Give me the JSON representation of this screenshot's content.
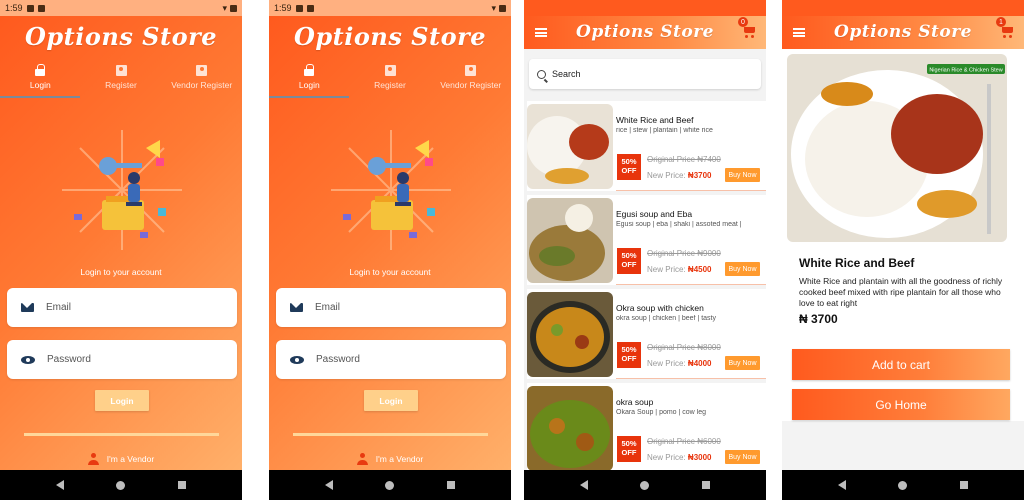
{
  "app": {
    "name": "Options Store"
  },
  "colors": {
    "primary": "#ff5a1e",
    "accent": "#e8340c",
    "button_light": "#ffd08a",
    "buy_button": "#ff9a2e"
  },
  "status": {
    "time": "1:59"
  },
  "login": {
    "tabs": [
      {
        "label": "Login",
        "icon": "lock-icon"
      },
      {
        "label": "Register",
        "icon": "badge-icon"
      },
      {
        "label": "Vendor Register",
        "icon": "badge-icon"
      }
    ],
    "subtitle": "Login to your account",
    "email_placeholder": "Email",
    "password_placeholder": "Password",
    "button_label": "Login",
    "vendor_link": "I'm a Vendor"
  },
  "list": {
    "cart_count": "0",
    "search_placeholder": "Search",
    "items": [
      {
        "title": "White Rice and Beef",
        "tags": "rice | stew | plantain | white rice",
        "discount_pct": "50%",
        "discount_label": "OFF",
        "original_price": "Original Price ₦7400",
        "new_price_label": "New Price:",
        "new_price": "₦3700",
        "buy_label": "Buy Now"
      },
      {
        "title": "Egusi soup and Eba",
        "tags": "Egusi soup | eba | shaki | assoted meat |",
        "discount_pct": "50%",
        "discount_label": "OFF",
        "original_price": "Original Price ₦9000",
        "new_price_label": "New Price:",
        "new_price": "₦4500",
        "buy_label": "Buy Now"
      },
      {
        "title": "Okra soup with chicken",
        "tags": "okra soup | chicken | beef | tasty",
        "discount_pct": "50%",
        "discount_label": "OFF",
        "original_price": "Original Price ₦8000",
        "new_price_label": "New Price:",
        "new_price": "₦4000",
        "buy_label": "Buy Now"
      },
      {
        "title": "okra soup",
        "tags": "Okara Soup | pomo | cow leg",
        "discount_pct": "50%",
        "discount_label": "OFF",
        "original_price": "Original Price ₦6000",
        "new_price_label": "New Price:",
        "new_price": "₦3000",
        "buy_label": "Buy Now"
      }
    ]
  },
  "detail": {
    "cart_count": "1",
    "image_caption": "Nigerian Rice & Chicken Stew",
    "title": "White Rice and Beef",
    "description": "White Rice and plantain with all the goodness of richly cooked beef mixed with ripe plantain for all those who love to eat right",
    "price": "₦ 3700",
    "add_to_cart_label": "Add to cart",
    "go_home_label": "Go Home"
  }
}
